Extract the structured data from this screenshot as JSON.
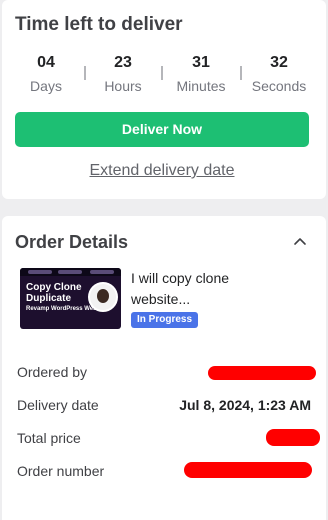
{
  "delivery": {
    "title": "Time left to deliver",
    "countdown": [
      {
        "value": "04",
        "unit": "Days"
      },
      {
        "value": "23",
        "unit": "Hours"
      },
      {
        "value": "31",
        "unit": "Minutes"
      },
      {
        "value": "32",
        "unit": "Seconds"
      }
    ],
    "deliver_button": "Deliver Now",
    "extend_link": "Extend delivery date"
  },
  "order": {
    "title": "Order Details",
    "collapse_icon": "chevron-up-icon",
    "gig": {
      "title": "I will copy clone website...",
      "status": "In Progress",
      "thumbnail": {
        "headline": "Copy Clone Duplicate",
        "subline": "Revamp WordPress Website"
      }
    },
    "rows": [
      {
        "label": "Ordered by",
        "value": ""
      },
      {
        "label": "Delivery date",
        "value": "Jul 8, 2024, 1:23 AM"
      },
      {
        "label": "Total price",
        "value": ""
      },
      {
        "label": "Order number",
        "value": ""
      }
    ]
  },
  "colors": {
    "accent_green": "#1dbf73",
    "status_blue": "#4a73e8",
    "redaction_red": "#ff0000"
  }
}
